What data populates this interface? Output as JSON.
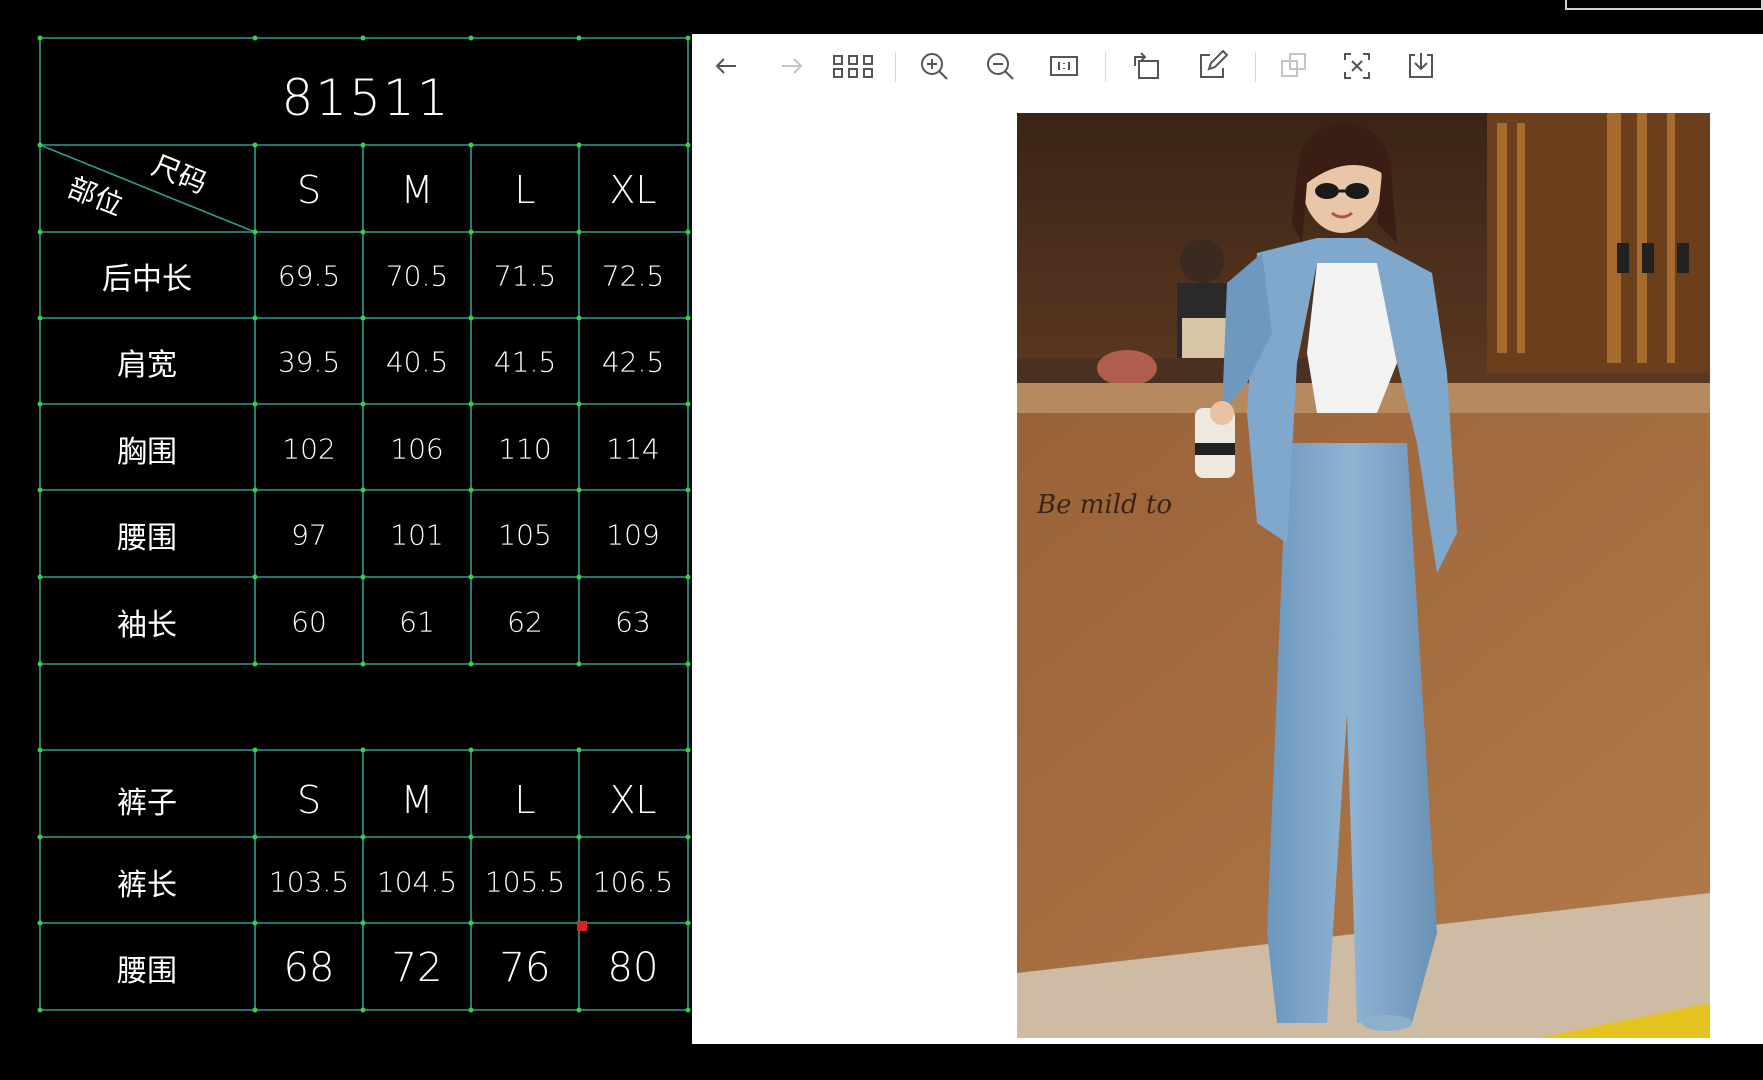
{
  "table": {
    "title": "81511",
    "corner_top": "尺码",
    "corner_bottom": "部位",
    "sizes": [
      "S",
      "M",
      "L",
      "XL"
    ],
    "top_rows": [
      {
        "label": "后中长",
        "values": [
          "69.5",
          "70.5",
          "71.5",
          "72.5"
        ]
      },
      {
        "label": "肩宽",
        "values": [
          "39.5",
          "40.5",
          "41.5",
          "42.5"
        ]
      },
      {
        "label": "胸围",
        "values": [
          "102",
          "106",
          "110",
          "114"
        ]
      },
      {
        "label": "腰围",
        "values": [
          "97",
          "101",
          "105",
          "109"
        ]
      },
      {
        "label": "袖长",
        "values": [
          "60",
          "61",
          "62",
          "63"
        ]
      }
    ],
    "pants_header": "裤子",
    "pants_rows": [
      {
        "label": "裤长",
        "values": [
          "103.5",
          "104.5",
          "105.5",
          "106.5"
        ]
      },
      {
        "label": "腰围",
        "values": [
          "68",
          "72",
          "76",
          "80"
        ]
      }
    ]
  },
  "viewer": {
    "toolbar": [
      {
        "name": "back-arrow-icon",
        "enabled": true
      },
      {
        "name": "forward-arrow-icon",
        "enabled": false
      },
      {
        "name": "grid-view-icon",
        "enabled": true
      },
      {
        "name": "zoom-in-icon",
        "enabled": true
      },
      {
        "name": "zoom-out-icon",
        "enabled": true
      },
      {
        "name": "actual-size-icon",
        "enabled": true
      },
      {
        "name": "rotate-icon",
        "enabled": true
      },
      {
        "name": "edit-icon",
        "enabled": true
      },
      {
        "name": "copy-icon",
        "enabled": false
      },
      {
        "name": "ocr-scan-icon",
        "enabled": true
      },
      {
        "name": "download-icon",
        "enabled": true
      }
    ]
  },
  "colors": {
    "grid_line": "#2e9c8e",
    "grid_node": "#33d24a",
    "icon": "#555555",
    "icon_disabled": "#c4c4c4",
    "suit_blue": "#7aa3c6"
  }
}
